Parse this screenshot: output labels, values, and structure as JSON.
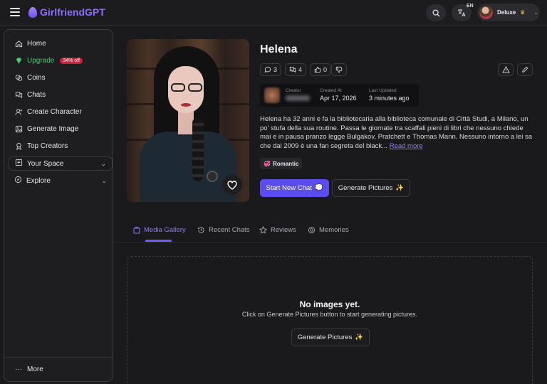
{
  "header": {
    "brand": "GirlfriendGPT",
    "lang_code": "EN",
    "user": {
      "name": "Deluxe",
      "crown": "♛"
    }
  },
  "sidebar": {
    "items": [
      {
        "label": "Home",
        "icon": "home-icon"
      },
      {
        "label": "Upgrade",
        "icon": "diamond-icon",
        "badge": "34% off"
      },
      {
        "label": "Coins",
        "icon": "coins-icon"
      },
      {
        "label": "Chats",
        "icon": "chat-icon"
      },
      {
        "label": "Create Character",
        "icon": "user-plus-icon"
      },
      {
        "label": "Generate Image",
        "icon": "image-icon"
      },
      {
        "label": "Top Creators",
        "icon": "award-icon"
      }
    ],
    "groups": [
      {
        "label": "Your Space",
        "icon": "space-icon"
      },
      {
        "label": "Explore",
        "icon": "compass-icon"
      }
    ],
    "more": "More"
  },
  "character": {
    "name": "Helena",
    "stats": {
      "chats": "3",
      "messages": "4",
      "likes": "0"
    },
    "meta": {
      "creator_label": "Creator",
      "created_label": "Created At",
      "created_value": "Apr 17, 2026",
      "updated_label": "Last Updated",
      "updated_value": "3 minutes ago"
    },
    "description": "Helena ha 32 anni e fa la bibliotecaria alla biblioteca comunale di Città Studi, a Milano, un po' stufa della sua routine. Passa le giornate tra scaffali pieni di libri che nessuno chiede mai e in pausa pranzo legge Bulgakov, Pratchett e Thomas Mann. Nessuno intorno a lei sa che dal 2009 è una fan segreta del black...",
    "read_more": "Read more",
    "tag": "Romantic",
    "tag_emoji": "💞",
    "start_chat": "Start New Chat",
    "start_chat_emoji": "💭",
    "generate_pictures": "Generate Pictures",
    "sparkle": "✨"
  },
  "tabs": [
    {
      "label": "Media Gallery",
      "active": true
    },
    {
      "label": "Recent Chats"
    },
    {
      "label": "Reviews"
    },
    {
      "label": "Memories"
    }
  ],
  "gallery": {
    "empty_title": "No images yet.",
    "empty_subtitle": "Click on Generate Pictures button to start generating pictures.",
    "button": "Generate Pictures"
  }
}
